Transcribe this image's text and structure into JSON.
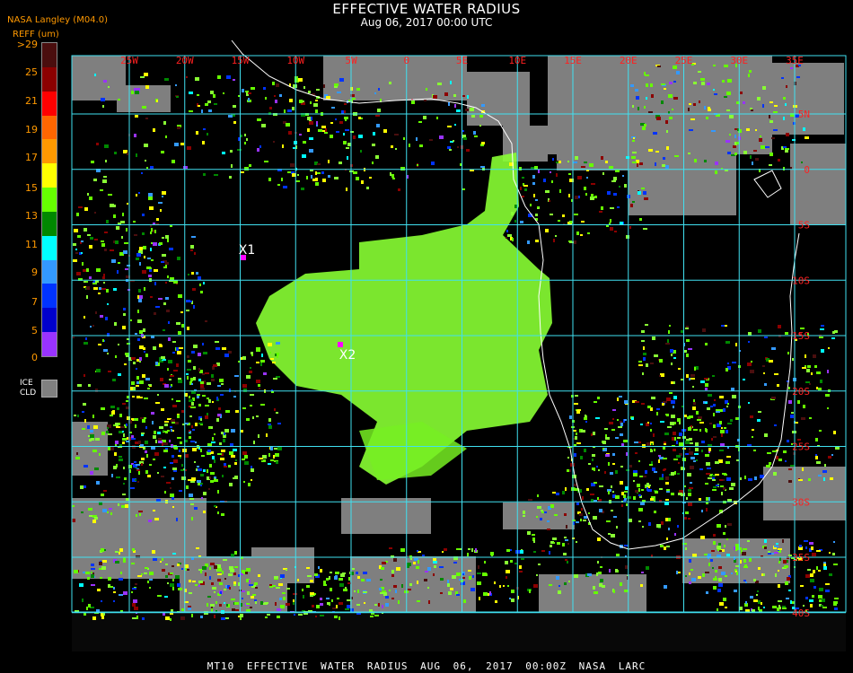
{
  "header": {
    "title": "EFFECTIVE WATER RADIUS",
    "subtitle": "Aug 06, 2017 00:00 UTC",
    "source": "NASA Langley (M04.0)",
    "unit": "REFF (um)"
  },
  "legend": {
    "labels": [
      ">29",
      "25",
      "21",
      "19",
      "17",
      "15",
      "13",
      "11",
      "9",
      "7",
      "5",
      "0"
    ],
    "colors": [
      "#4a0e0e",
      "#8c0000",
      "#ff0000",
      "#ff6600",
      "#ff9900",
      "#ffff00",
      "#66ff00",
      "#008800",
      "#00ffff",
      "#3399ff",
      "#0033ff",
      "#0000cc",
      "#9933ff"
    ],
    "ice_label_1": "ICE",
    "ice_label_2": "CLD",
    "ice_color": "#808080"
  },
  "map": {
    "lon_labels": [
      "25W",
      "20W",
      "15W",
      "10W",
      "5W",
      "0",
      "5E",
      "10E",
      "15E",
      "20E",
      "25E",
      "30E",
      "35E"
    ],
    "lat_labels": [
      "5N",
      "0",
      "5S",
      "10S",
      "15S",
      "20S",
      "25S",
      "30S",
      "35S",
      "40S"
    ],
    "grid_color": "#40e0f0",
    "label_color": "#ff2020",
    "markers": [
      {
        "label": "X1",
        "color": "#ff00ff"
      },
      {
        "label": "X2",
        "color": "#ff00ff"
      }
    ]
  },
  "footer": {
    "text": "MT10  EFFECTIVE WATER RADIUS  AUG 06, 2017 00:00Z  NASA LARC"
  }
}
